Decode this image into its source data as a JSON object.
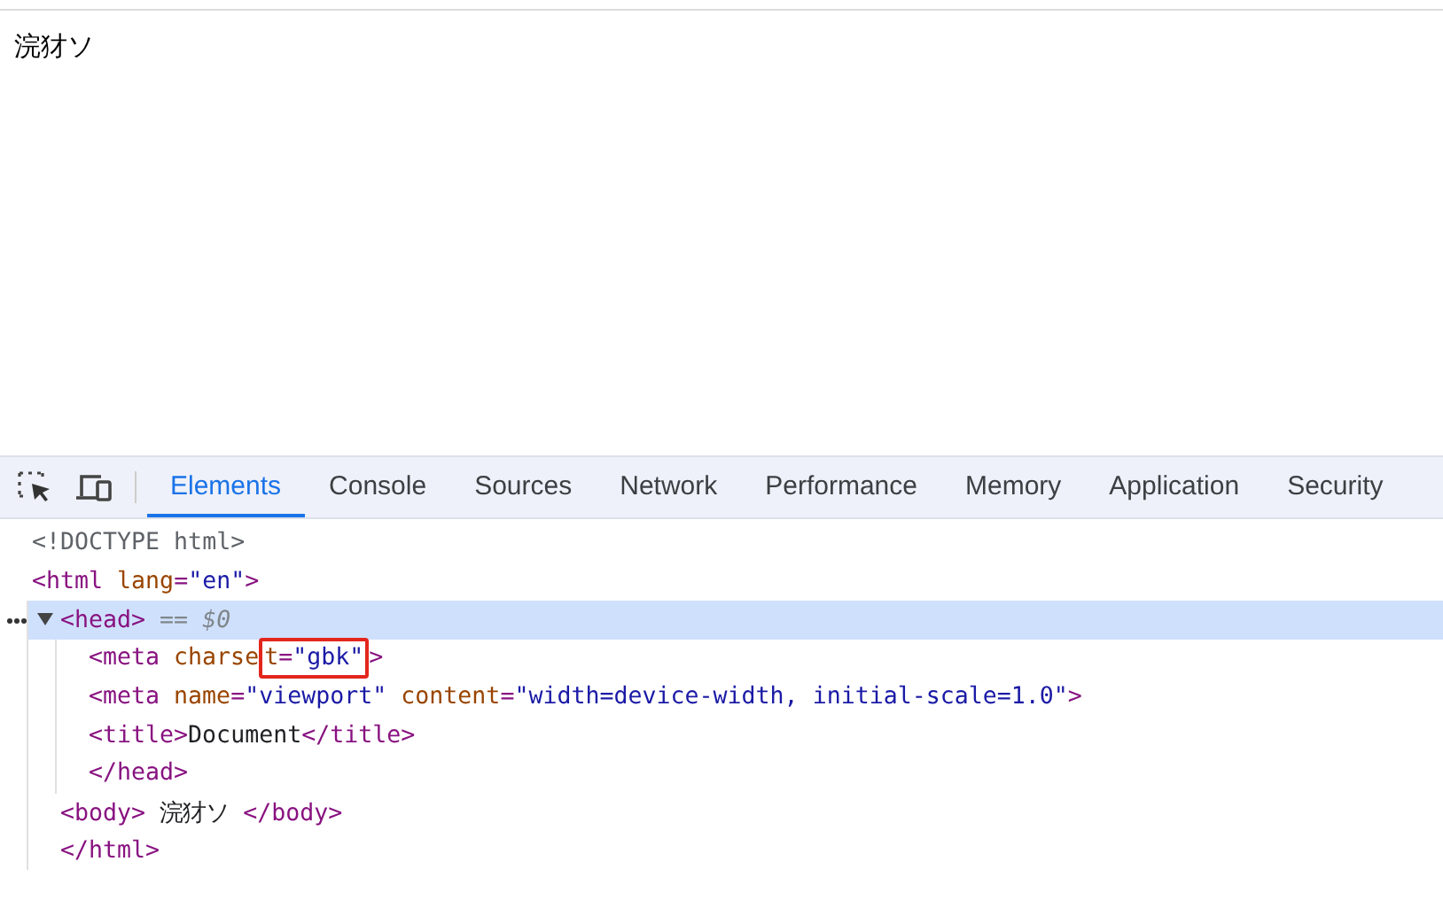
{
  "page": {
    "body_text": "浣犲ソ"
  },
  "devtools": {
    "tabs": [
      {
        "label": "Elements",
        "selected": true
      },
      {
        "label": "Console",
        "selected": false
      },
      {
        "label": "Sources",
        "selected": false
      },
      {
        "label": "Network",
        "selected": false
      },
      {
        "label": "Performance",
        "selected": false
      },
      {
        "label": "Memory",
        "selected": false
      },
      {
        "label": "Application",
        "selected": false
      },
      {
        "label": "Security",
        "selected": false
      }
    ],
    "dom": [
      {
        "tokens": [
          {
            "kind": "doctype",
            "text": "<!DOCTYPE html>"
          }
        ],
        "selected": false
      },
      {
        "tokens": [
          {
            "kind": "tag",
            "text": "<html"
          },
          {
            "kind": "attr",
            "text": " lang"
          },
          {
            "kind": "tag",
            "text": "="
          },
          {
            "kind": "value",
            "text": "\"en\""
          },
          {
            "kind": "tag",
            "text": ">"
          }
        ],
        "selected": false,
        "children": [
          {
            "tokens": [
              {
                "kind": "tag",
                "text": "<head>"
              },
              {
                "kind": "hint",
                "text": " == $0"
              }
            ],
            "selected": true,
            "expanded": true,
            "children": [
              {
                "tokens": [
                  {
                    "kind": "tag",
                    "text": "<meta"
                  },
                  {
                    "kind": "attr",
                    "text": " charse"
                  },
                  {
                    "kind": "attr",
                    "text": "t",
                    "boxed": true
                  },
                  {
                    "kind": "tag",
                    "text": "=",
                    "boxed": true
                  },
                  {
                    "kind": "value",
                    "text": "\"gbk\"",
                    "boxed": true
                  },
                  {
                    "kind": "tag",
                    "text": ">"
                  }
                ],
                "selected": false
              },
              {
                "tokens": [
                  {
                    "kind": "tag",
                    "text": "<meta"
                  },
                  {
                    "kind": "attr",
                    "text": " name"
                  },
                  {
                    "kind": "tag",
                    "text": "="
                  },
                  {
                    "kind": "value",
                    "text": "\"viewport\""
                  },
                  {
                    "kind": "attr",
                    "text": " content"
                  },
                  {
                    "kind": "tag",
                    "text": "="
                  },
                  {
                    "kind": "value",
                    "text": "\"width=device-width, initial-scale=1.0\""
                  },
                  {
                    "kind": "tag",
                    "text": ">"
                  }
                ],
                "selected": false
              },
              {
                "tokens": [
                  {
                    "kind": "tag",
                    "text": "<title>"
                  },
                  {
                    "kind": "text",
                    "text": "Document"
                  },
                  {
                    "kind": "tag",
                    "text": "</title>"
                  }
                ],
                "selected": false
              }
            ],
            "closing": [
              {
                "kind": "tag",
                "text": "</head>"
              }
            ]
          },
          {
            "tokens": [
              {
                "kind": "tag",
                "text": "<body>"
              },
              {
                "kind": "text",
                "text": " 浣犲ソ "
              },
              {
                "kind": "tag",
                "text": "</body>"
              }
            ],
            "selected": false
          }
        ],
        "closing": [
          {
            "kind": "tag",
            "text": "</html>"
          }
        ]
      }
    ]
  }
}
